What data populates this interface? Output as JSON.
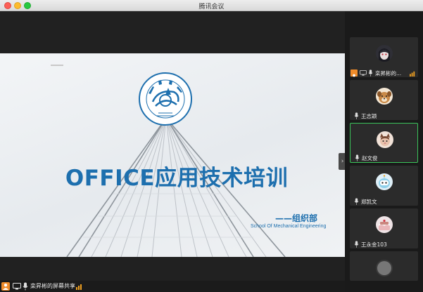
{
  "window": {
    "title": "腾讯会议"
  },
  "slide": {
    "title": "OFFICE应用技术培训",
    "department": "——组织部",
    "school": "School Of Mechanical Engineering"
  },
  "sharing": {
    "presenter_label": "栾昇彬的屏幕共享"
  },
  "participants": [
    {
      "name": "栾昇彬的...",
      "icon": "host-badge",
      "is_host": true,
      "active": false
    },
    {
      "name": "王志颖",
      "icon": "dog-avatar",
      "is_host": false,
      "active": false
    },
    {
      "name": "赵文俊",
      "icon": "cat-avatar",
      "is_host": false,
      "active": true
    },
    {
      "name": "郑凯文",
      "icon": "robot-avatar",
      "is_host": false,
      "active": false
    },
    {
      "name": "王永金103",
      "icon": "cake-avatar",
      "is_host": false,
      "active": false
    }
  ],
  "colors": {
    "accent": "#1d6fae",
    "host": "#f08c2a",
    "active_border": "#3ac35a"
  }
}
